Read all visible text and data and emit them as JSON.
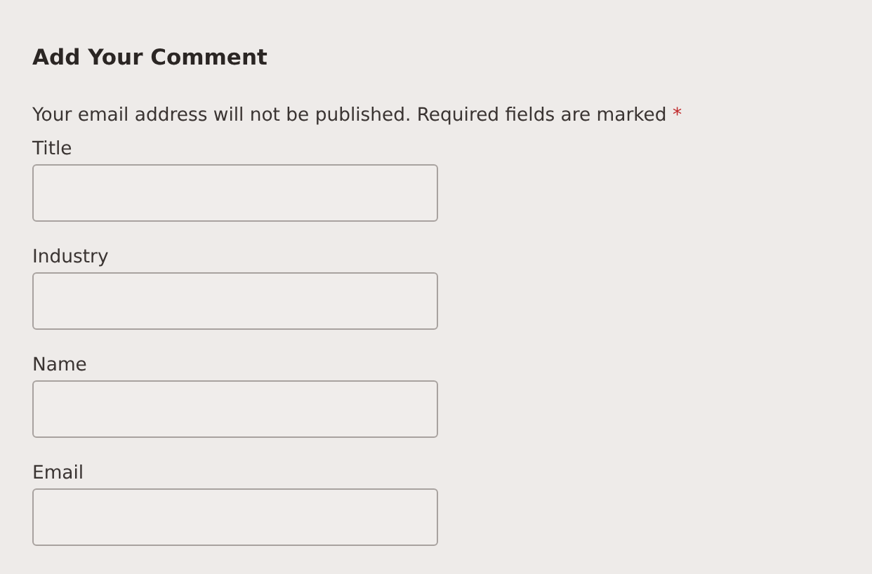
{
  "heading": "Add Your Comment",
  "notice": {
    "text": "Your email address will not be published. Required fields are marked",
    "required_mark": "*"
  },
  "fields": [
    {
      "label": "Title"
    },
    {
      "label": "Industry"
    },
    {
      "label": "Name"
    },
    {
      "label": "Email"
    }
  ]
}
